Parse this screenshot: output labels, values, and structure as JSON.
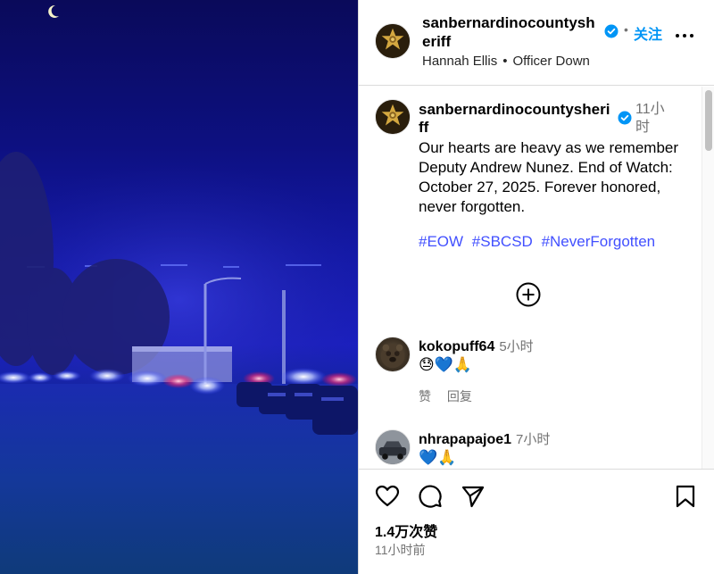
{
  "post": {
    "username": "sanbernardinocountysheriff",
    "follow_label": "关注",
    "dot": "•",
    "subheader": {
      "person": "Hannah Ellis",
      "separator": "•",
      "audio": "Officer Down"
    }
  },
  "caption": {
    "username": "sanbernardinocountysheriff",
    "time": "11小时",
    "text": "Our hearts are heavy as we remember Deputy Andrew Nunez. End of Watch: October 27, 2025. Forever honored, never forgotten.",
    "hashtags": [
      "#EOW",
      "#SBCSD",
      "#NeverForgotten"
    ]
  },
  "comments": [
    {
      "username": "kokopuff64",
      "time": "5小时",
      "text": "😓💙🙏",
      "like_label": "赞",
      "reply_label": "回复"
    },
    {
      "username": "nhrapapajoe1",
      "time": "7小时",
      "text": "💙🙏"
    }
  ],
  "footer": {
    "likes": "1.4万次赞",
    "posted": "11小时前"
  },
  "icons": {
    "verified": "verified-badge-icon",
    "more": "more-options-icon",
    "load_more": "plus-circle-icon",
    "like": "heart-icon",
    "comment": "comment-bubble-icon",
    "share": "paper-plane-icon",
    "save": "bookmark-icon"
  },
  "colors": {
    "link": "#0095f6",
    "hashtag": "#4250ff",
    "verified": "#0095f6",
    "muted": "#737373",
    "photo_blue": "#1b1fc0"
  }
}
